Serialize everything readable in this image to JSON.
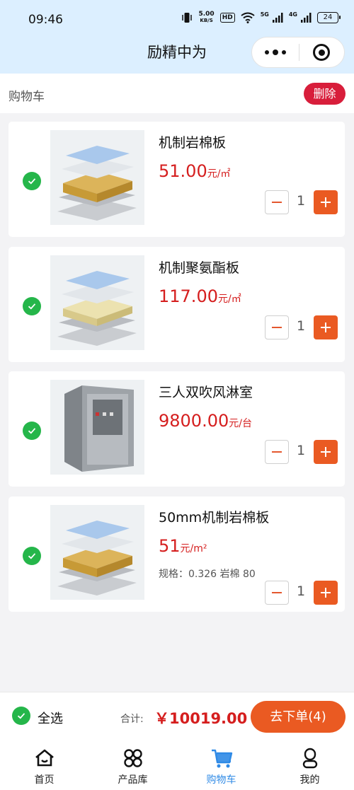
{
  "status_bar": {
    "time": "09:46",
    "net_speed_value": "5.00",
    "net_speed_unit": "KB/S",
    "hd_label": "HD",
    "sig1_label": "5G",
    "sig2_label": "4G",
    "battery": "24"
  },
  "nav": {
    "title": "励精中为"
  },
  "cart": {
    "title": "购物车",
    "delete_label": "删除"
  },
  "items": [
    {
      "name": "机制岩棉板",
      "price": "51.00",
      "unit": "元/㎡",
      "spec": "",
      "qty": "1",
      "image": "rockwool-panel-image"
    },
    {
      "name": "机制聚氨酯板",
      "price": "117.00",
      "unit": "元/㎡",
      "spec": "",
      "qty": "1",
      "image": "polyurethane-panel-image"
    },
    {
      "name": "三人双吹风淋室",
      "price": "9800.00",
      "unit": "元/台",
      "spec": "",
      "qty": "1",
      "image": "air-shower-image"
    },
    {
      "name": "50mm机制岩棉板",
      "price": "51",
      "unit": "元/m²",
      "spec": "规格：0.326 岩棉 80",
      "qty": "1",
      "image": "rockwool-panel-image"
    }
  ],
  "checkout": {
    "select_all_label": "全选",
    "total_label": "合计:",
    "total_value": "￥10019.00",
    "order_button": "去下单(4)"
  },
  "tabs": [
    {
      "label": "首页",
      "icon": "home-icon"
    },
    {
      "label": "产品库",
      "icon": "product-grid-icon"
    },
    {
      "label": "购物车",
      "icon": "cart-icon",
      "active": true
    },
    {
      "label": "我的",
      "icon": "profile-icon"
    }
  ],
  "colors": {
    "accent": "#ea5a22",
    "price": "#d51e1e",
    "check": "#25b64a",
    "delete": "#d81e3b",
    "active_tab": "#2f8ae6"
  }
}
